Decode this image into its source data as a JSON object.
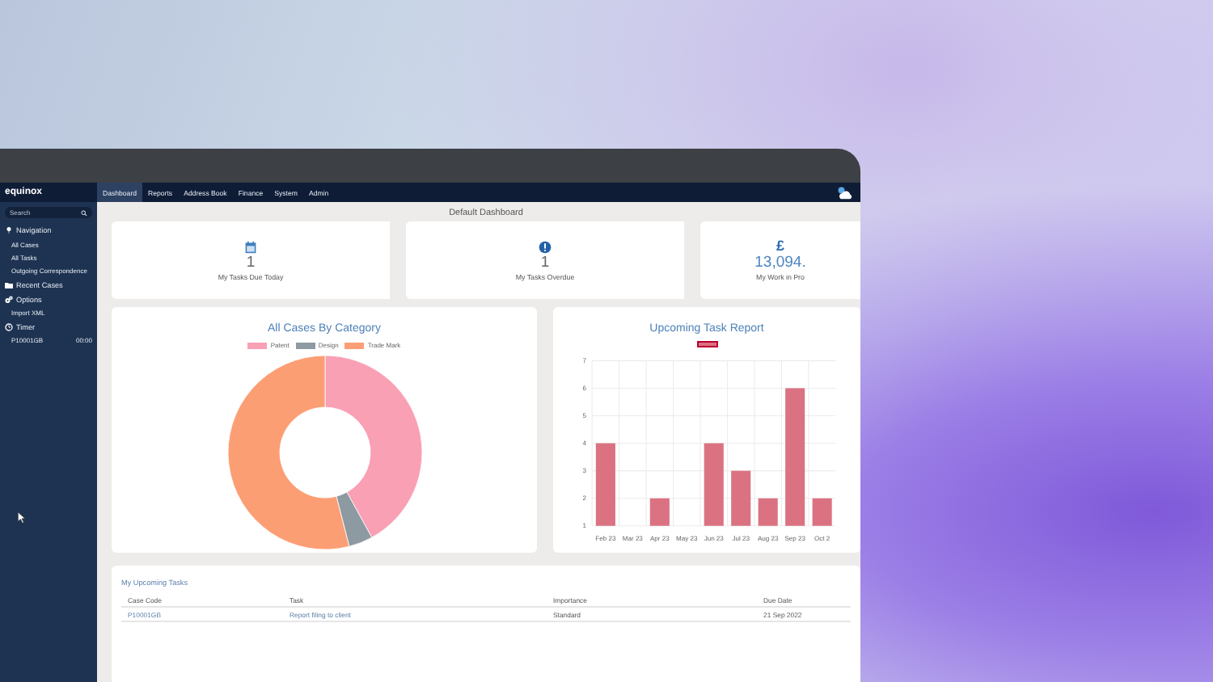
{
  "logo": "equinox",
  "nav_tabs": [
    {
      "label": "Dashboard",
      "selected": true
    },
    {
      "label": "Reports",
      "selected": false
    },
    {
      "label": "Address Book",
      "selected": false
    },
    {
      "label": "Finance",
      "selected": false
    },
    {
      "label": "System",
      "selected": false
    },
    {
      "label": "Admin",
      "selected": false
    }
  ],
  "sidebar": {
    "search": {
      "placeholder": "Search"
    },
    "sections": [
      {
        "kind": "pin",
        "title": "Navigation",
        "items": [
          {
            "label": "All Cases"
          },
          {
            "label": "All Tasks"
          },
          {
            "label": "Outgoing Correspondence"
          }
        ]
      },
      {
        "kind": "folder",
        "title": "Recent Cases"
      },
      {
        "kind": "gears",
        "title": "Options",
        "items": [
          {
            "label": "Import XML"
          }
        ]
      },
      {
        "kind": "clock",
        "title": "Timer",
        "items": [
          {
            "label": "P10001GB",
            "time": "00:00"
          }
        ]
      }
    ]
  },
  "page_title": "Default Dashboard",
  "cards": [
    {
      "kind": "calendar",
      "value": "1",
      "label": "My Tasks Due Today"
    },
    {
      "kind": "alert",
      "value": "1",
      "label": "My Tasks Overdue"
    },
    {
      "kind": "currency",
      "symbol": "£",
      "value": "13,094.",
      "label": "My Work in Pro"
    }
  ],
  "category_chart": {
    "title": "All Cases By Category",
    "legend": [
      {
        "label": "Patent",
        "color": "#f9a0b5"
      },
      {
        "label": "Design",
        "color": "#8e9aa1"
      },
      {
        "label": "Trade Mark",
        "color": "#fc9e74"
      }
    ]
  },
  "task_report": {
    "title": "Upcoming Task Report",
    "chart_data": {
      "type": "bar",
      "categories": [
        "Feb 23",
        "Mar 23",
        "Apr 23",
        "May 23",
        "Jun 23",
        "Jul 23",
        "Aug 23",
        "Sep 23",
        "Oct 2"
      ],
      "series": [
        {
          "color": "#db7282",
          "values": [
            4,
            null,
            2,
            null,
            4,
            3,
            2,
            6,
            2
          ]
        }
      ],
      "grid": true,
      "ylim": [
        1,
        7
      ],
      "yticks": [
        1,
        2,
        3,
        4,
        5,
        6,
        7
      ]
    }
  },
  "tasks_table": {
    "title": "My Upcoming Tasks",
    "columns": [
      "Case Code",
      "Task",
      "Importance",
      "Due Date"
    ],
    "rows": [
      [
        "P10001GB",
        "Report filing to client",
        "Standard",
        "21 Sep 2022"
      ]
    ]
  }
}
